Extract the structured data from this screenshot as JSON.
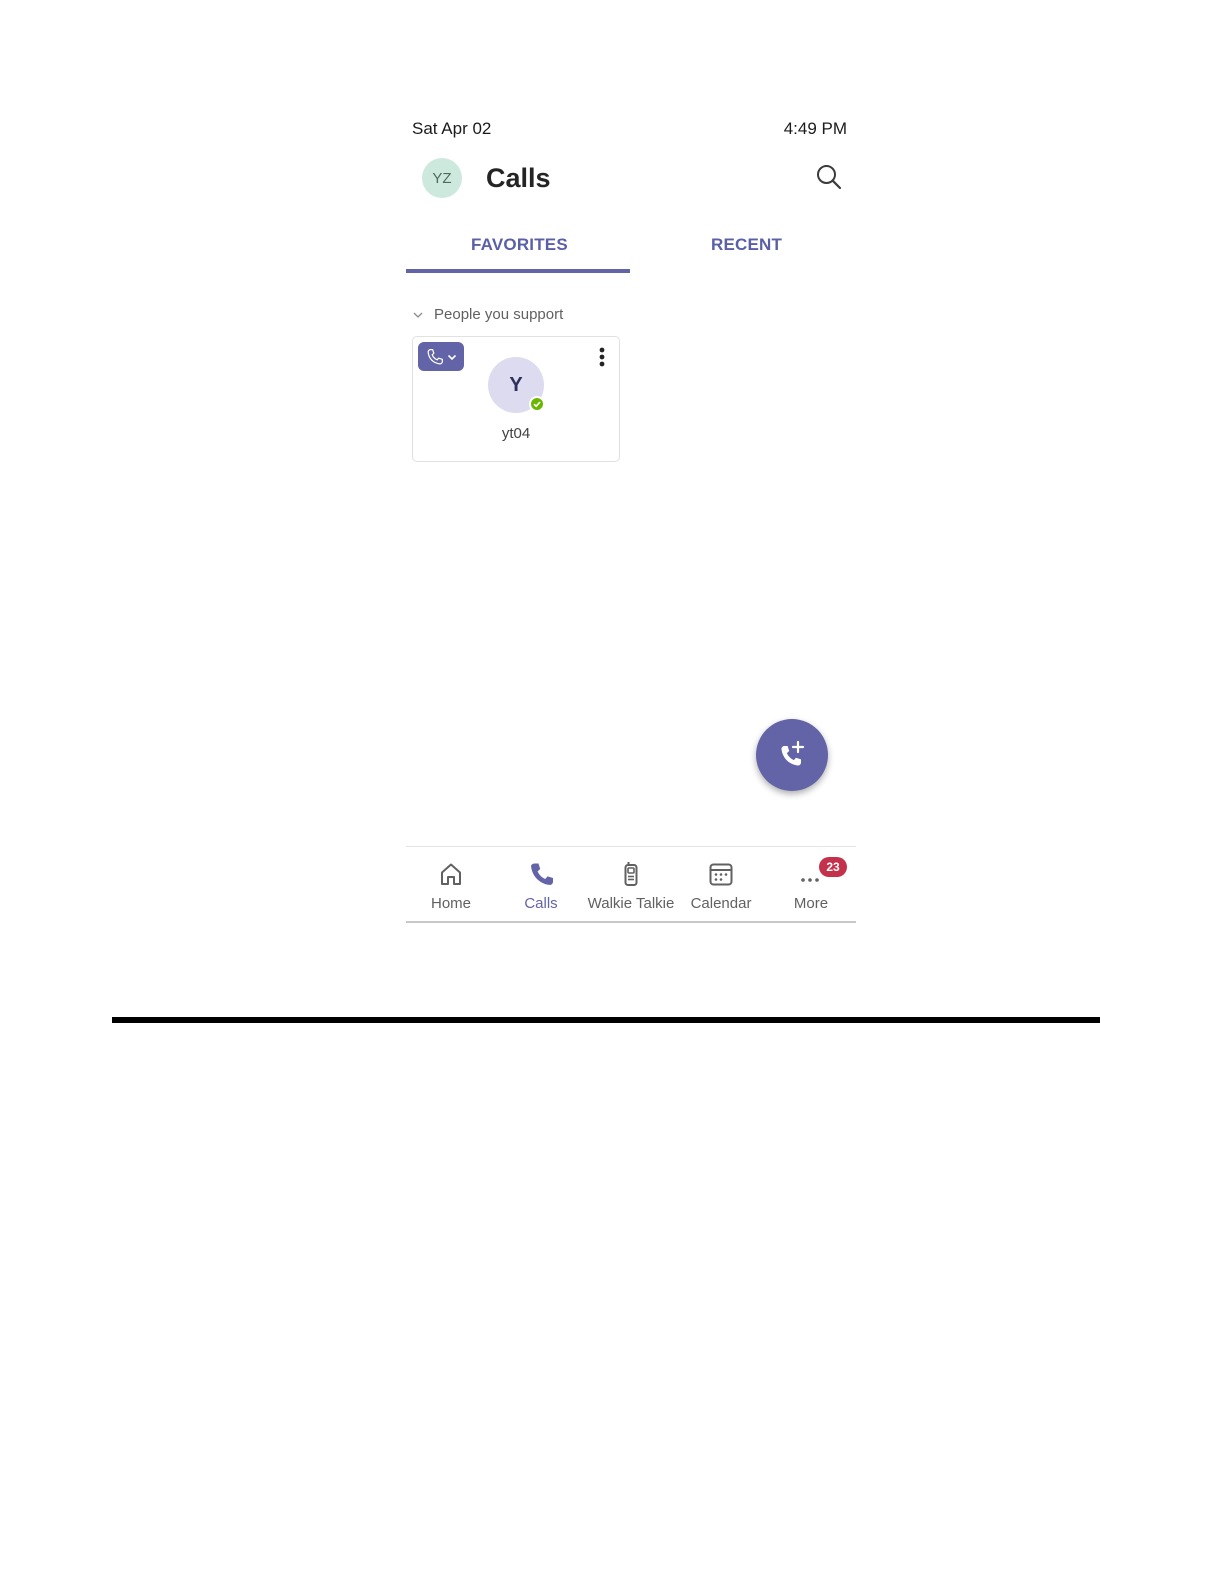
{
  "status_bar": {
    "date": "Sat Apr 02",
    "time": "4:49 PM"
  },
  "header": {
    "avatar_initials": "YZ",
    "title": "Calls",
    "search_icon": "search-icon"
  },
  "tabs": [
    {
      "label": "FAVORITES",
      "selected": true
    },
    {
      "label": "RECENT",
      "selected": false
    }
  ],
  "favorites": {
    "group_label": "People you support",
    "contacts": [
      {
        "initial": "Y",
        "name": "yt04",
        "presence": "available"
      }
    ]
  },
  "fab": {
    "icon": "add-call-icon"
  },
  "bottom_nav": {
    "items": [
      {
        "label": "Home",
        "icon": "home-icon"
      },
      {
        "label": "Calls",
        "icon": "phone-icon",
        "active": true
      },
      {
        "label": "Walkie Talkie",
        "icon": "walkie-talkie-icon"
      },
      {
        "label": "Calendar",
        "icon": "calendar-icon"
      },
      {
        "label": "More",
        "icon": "more-icon",
        "badge": "23"
      }
    ]
  },
  "colors": {
    "accent": "#6264a7",
    "presence_available": "#6bb700",
    "badge": "#c4314b",
    "my_avatar_bg": "#cde9de",
    "contact_avatar_bg": "#dcdbf0"
  }
}
